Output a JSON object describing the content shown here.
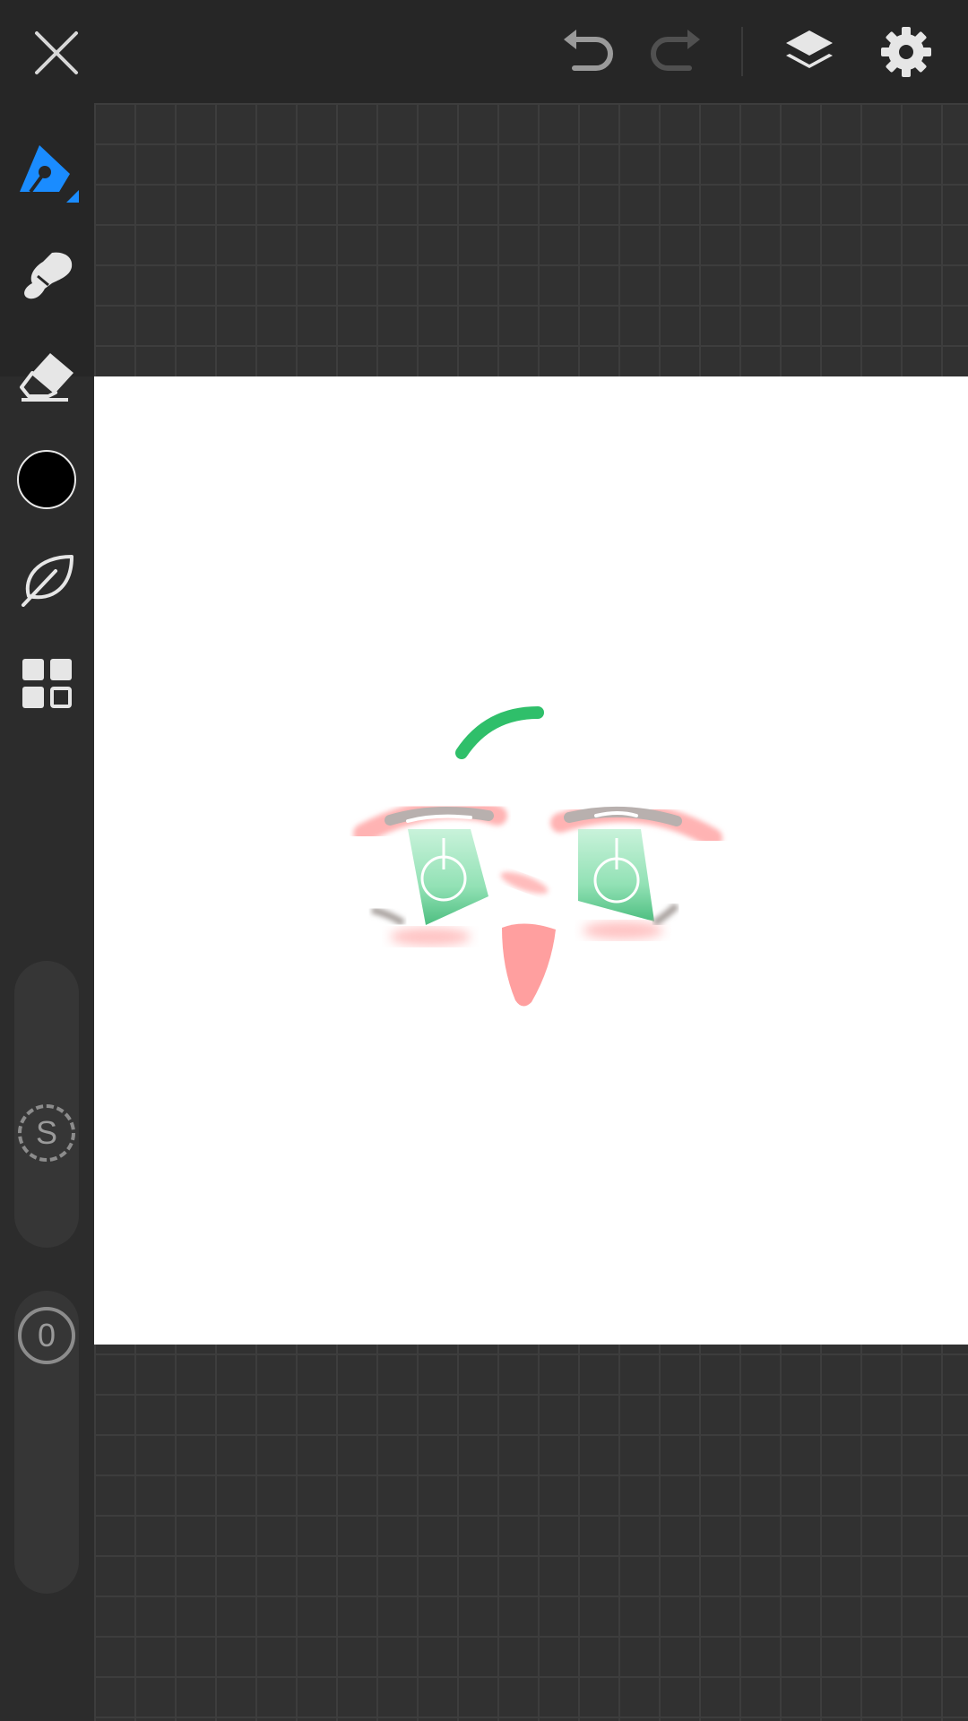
{
  "app": {
    "name": "drawing-app"
  },
  "toolbar": {
    "close_icon": "close-icon",
    "undo_icon": "undo-icon",
    "redo_icon": "redo-icon",
    "layers_icon": "layers-icon",
    "settings_icon": "gear-icon"
  },
  "tools": [
    {
      "name": "pen",
      "icon": "pen-icon",
      "active": true
    },
    {
      "name": "smudge",
      "icon": "smudge-icon",
      "active": false
    },
    {
      "name": "eraser",
      "icon": "eraser-icon",
      "active": false
    },
    {
      "name": "color",
      "icon": "color-swatch",
      "active": false
    },
    {
      "name": "brush-library",
      "icon": "leaf-icon",
      "active": false
    },
    {
      "name": "apps",
      "icon": "grid-icon",
      "active": false
    }
  ],
  "colors": {
    "accent": "#1a8cff",
    "current_color": "#000000",
    "canvas_background": "#ffffff"
  },
  "sliders": {
    "size_label": "S",
    "opacity_label": "0"
  }
}
